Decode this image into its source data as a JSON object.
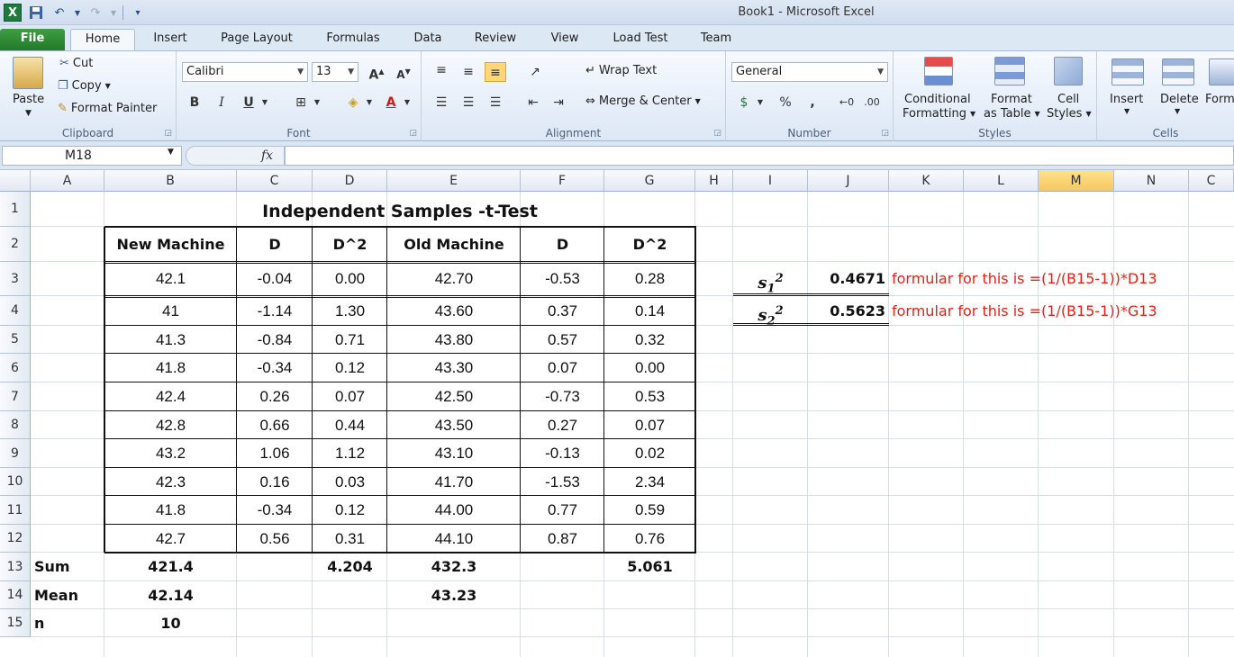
{
  "window": {
    "title": "Book1 -  Microsoft Excel",
    "app_icon": "X"
  },
  "tabs": [
    "File",
    "Home",
    "Insert",
    "Page Layout",
    "Formulas",
    "Data",
    "Review",
    "View",
    "Load Test",
    "Team"
  ],
  "ribbon": {
    "clipboard": {
      "label": "Clipboard",
      "paste": "Paste",
      "cut": "Cut",
      "copy": "Copy",
      "format_painter": "Format Painter"
    },
    "font": {
      "label": "Font",
      "name": "Calibri",
      "size": "13",
      "bold": "B",
      "italic": "I",
      "underline": "U"
    },
    "alignment": {
      "label": "Alignment",
      "wrap_text": "Wrap Text",
      "merge_center": "Merge & Center"
    },
    "number": {
      "label": "Number",
      "format": "General",
      "percent": "%",
      "comma": ","
    },
    "styles": {
      "label": "Styles",
      "conditional": "Conditional",
      "conditional2": "Formatting",
      "format_as": "Format",
      "format_as2": "as Table",
      "cell_styles": "Cell",
      "cell_styles2": "Styles"
    },
    "cells": {
      "label": "Cells",
      "insert": "Insert",
      "delete": "Delete",
      "format": "Form"
    }
  },
  "formula_bar": {
    "name_box": "M18",
    "fx": "fx",
    "formula": ""
  },
  "columns": [
    "A",
    "B",
    "C",
    "D",
    "E",
    "F",
    "G",
    "H",
    "I",
    "J",
    "K",
    "L",
    "M",
    "N",
    "C"
  ],
  "rows": [
    "1",
    "2",
    "3",
    "4",
    "5",
    "6",
    "7",
    "8",
    "9",
    "10",
    "11",
    "12",
    "13",
    "14",
    "15"
  ],
  "sheet": {
    "title": "Independent Samples -t-Test",
    "headers": [
      "New Machine",
      "D",
      "D^2",
      "Old Machine",
      "D",
      "D^2"
    ],
    "data": [
      [
        "42.1",
        "-0.04",
        "0.00",
        "42.70",
        "-0.53",
        "0.28"
      ],
      [
        "41",
        "-1.14",
        "1.30",
        "43.60",
        "0.37",
        "0.14"
      ],
      [
        "41.3",
        "-0.84",
        "0.71",
        "43.80",
        "0.57",
        "0.32"
      ],
      [
        "41.8",
        "-0.34",
        "0.12",
        "43.30",
        "0.07",
        "0.00"
      ],
      [
        "42.4",
        "0.26",
        "0.07",
        "42.50",
        "-0.73",
        "0.53"
      ],
      [
        "42.8",
        "0.66",
        "0.44",
        "43.50",
        "0.27",
        "0.07"
      ],
      [
        "43.2",
        "1.06",
        "1.12",
        "43.10",
        "-0.13",
        "0.02"
      ],
      [
        "42.3",
        "0.16",
        "0.03",
        "41.70",
        "-1.53",
        "2.34"
      ],
      [
        "41.8",
        "-0.34",
        "0.12",
        "44.00",
        "0.77",
        "0.59"
      ],
      [
        "42.7",
        "0.56",
        "0.31",
        "44.10",
        "0.87",
        "0.76"
      ]
    ],
    "sum": {
      "label": "Sum",
      "b": "421.4",
      "d": "4.204",
      "e": "432.3",
      "g": "5.061"
    },
    "mean": {
      "label": "Mean",
      "b": "42.14",
      "e": "43.23"
    },
    "n": {
      "label": "n",
      "b": "10"
    },
    "s1": {
      "sym": "s",
      "sub": "1",
      "sup": "2",
      "value": "0.4671",
      "note": "formular for this is =(1/(B15-1))*D13"
    },
    "s2": {
      "sym": "s",
      "sub": "2",
      "sup": "2",
      "value": "0.5623",
      "note": "formular for this is =(1/(B15-1))*G13"
    }
  },
  "colors": {
    "file_tab": "#2f8c35",
    "selected_header": "#f6c75f",
    "note": "#e0231a"
  }
}
